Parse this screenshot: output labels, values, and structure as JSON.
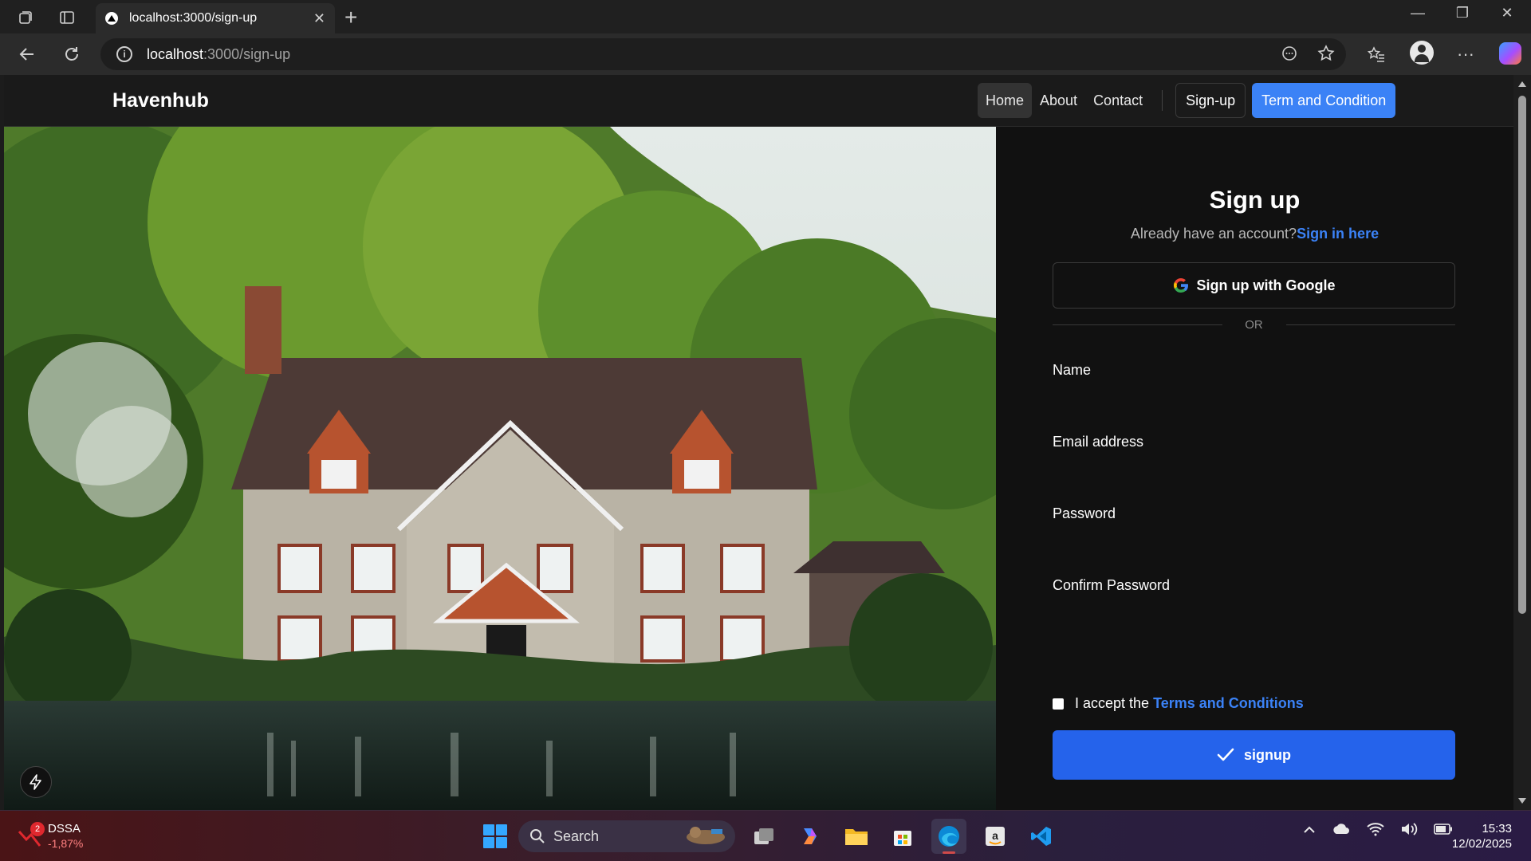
{
  "browser": {
    "tab_title": "localhost:3000/sign-up",
    "url_host": "localhost",
    "url_path": ":3000/sign-up",
    "icons": [
      "workspaces-icon",
      "tab-actions-icon",
      "back-icon",
      "refresh-icon",
      "site-info-icon",
      "reading-mode-icon",
      "favorite-star-icon",
      "favorites-icon",
      "profile-icon",
      "more-icon",
      "copilot-icon"
    ]
  },
  "nav": {
    "brand": "Havenhub",
    "links": [
      "Home",
      "About",
      "Contact"
    ],
    "active": "Home",
    "signup_label": "Sign-up",
    "terms_label": "Term and Condition",
    "accent": "#3b82f6"
  },
  "form": {
    "title": "Sign up",
    "have_account": "Already have an account?",
    "signin_link": "Sign in here",
    "google_label": "Sign up with Google",
    "or_text": "OR",
    "fields": [
      {
        "label": "Name",
        "value": ""
      },
      {
        "label": "Email address",
        "value": ""
      },
      {
        "label": "Password",
        "value": ""
      },
      {
        "label": "Confirm Password",
        "value": ""
      }
    ],
    "terms_prefix": "I accept the",
    "terms_link": "Terms and Conditions",
    "terms_checked": false,
    "submit_label": "signup",
    "submit_color": "#2563eb"
  },
  "taskbar": {
    "widget_badge": "2",
    "widget_name": "DSSA",
    "widget_change": "-1,87%",
    "search_label": "Search",
    "time": "15:33",
    "date": "12/02/2025"
  }
}
